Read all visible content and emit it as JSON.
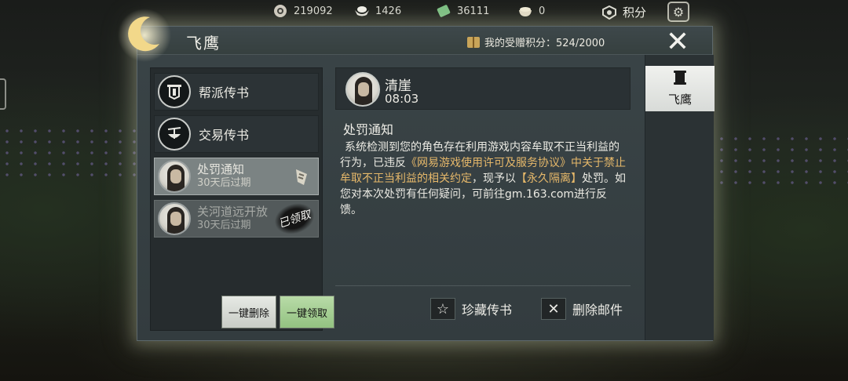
{
  "currencies": {
    "silver": {
      "icon": "coin-icon",
      "value": "219092"
    },
    "ingot": {
      "icon": "ingot-icon",
      "value": "1426"
    },
    "jade": {
      "icon": "jade-icon",
      "value": "36111"
    },
    "bowl": {
      "icon": "bowl-icon",
      "value": "0"
    },
    "points_label": "积分"
  },
  "panel": {
    "title": "飞鹰",
    "credit_text": "我的受赠积分：524/2000"
  },
  "mail_categories": [
    {
      "label": "帮派传书",
      "icon": "banner-icon"
    },
    {
      "label": "交易传书",
      "icon": "scale-icon"
    }
  ],
  "mails": [
    {
      "title": "处罚通知",
      "expiry": "30天后过期",
      "selected": true
    },
    {
      "title": "关河道远开放",
      "expiry": "30天后过期",
      "stamp": "已领取",
      "selected": false
    }
  ],
  "buttons": {
    "delete_all": "一键删除",
    "claim_all": "一键领取",
    "favorite": "珍藏传书",
    "delete_mail": "删除邮件"
  },
  "message": {
    "sender": "清崖",
    "time": "08:03",
    "title": "处罚通知",
    "body_part1": "系统检测到您的角色存在利用游戏内容牟取不正当利益的行为，已违反",
    "body_highlight1": "《网易游戏使用许可及服务协议》中关于禁止牟取不正当利益的相关约定",
    "body_part2": "，现予以",
    "body_highlight2": "【永久隔离】",
    "body_part3": "处罚。如您对本次处罚有任何疑问，可前往gm.163.com进行反馈。"
  },
  "side_tab": {
    "label": "飞鹰",
    "icon": "scroll-icon"
  },
  "colors": {
    "highlight": "#e6b86a",
    "claim_button": "#a6cf94",
    "panel_bg": "#37403f"
  }
}
